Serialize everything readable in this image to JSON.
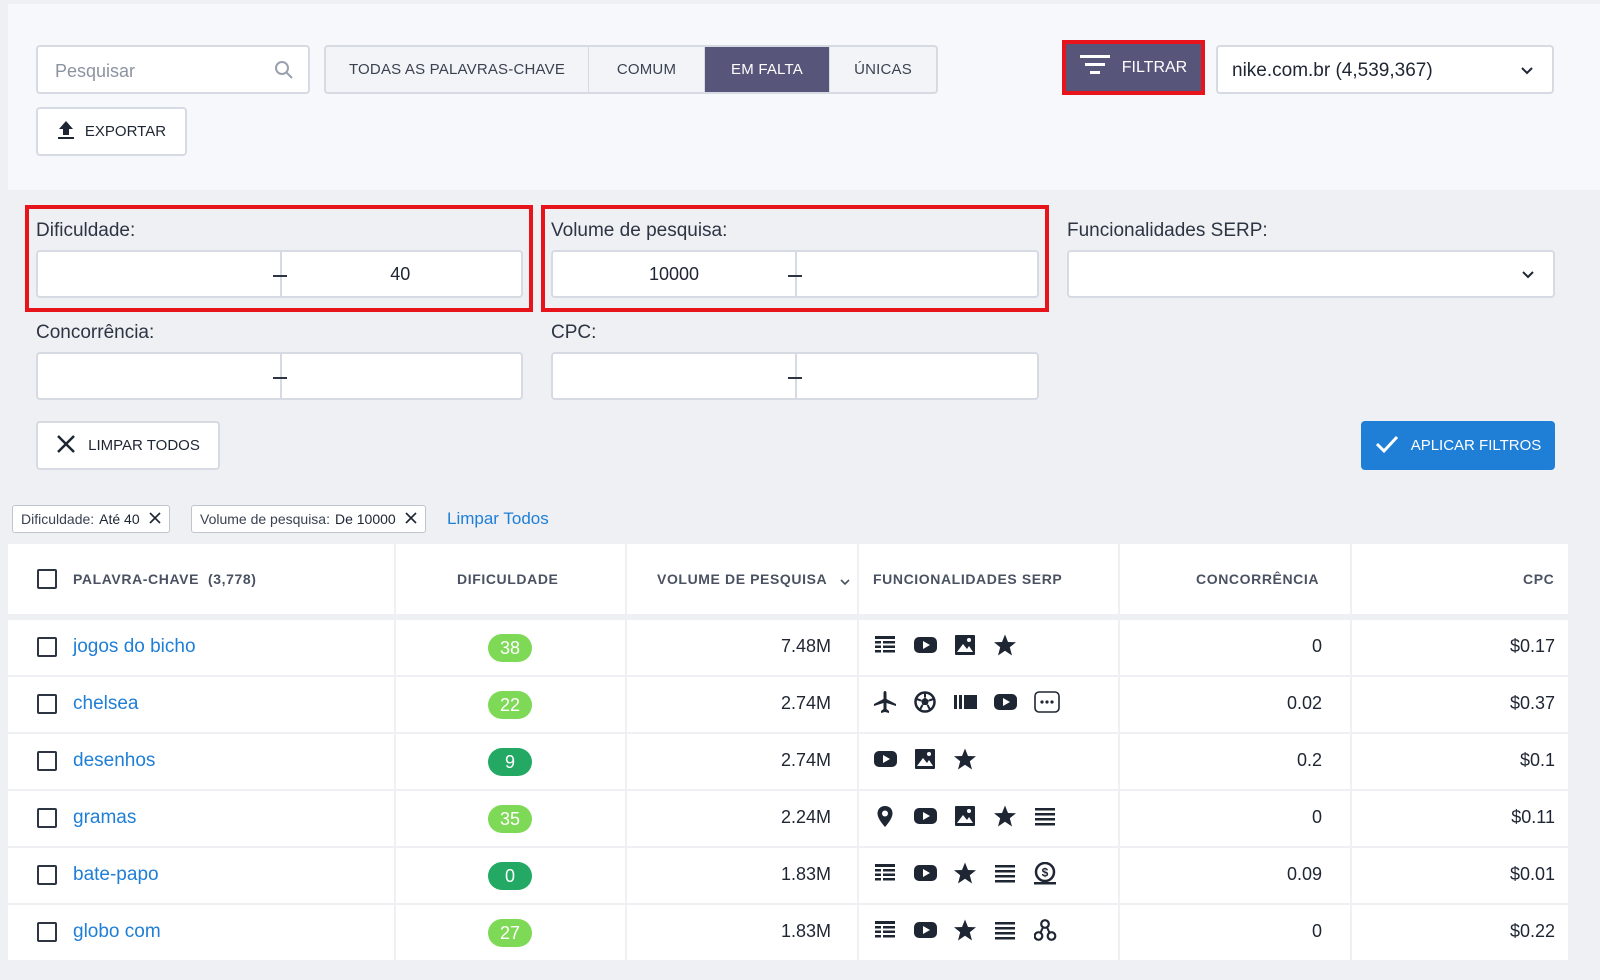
{
  "search": {
    "placeholder": "Pesquisar"
  },
  "tabs": [
    {
      "label": "TODAS AS PALAVRAS-CHAVE"
    },
    {
      "label": "COMUM"
    },
    {
      "label": "EM FALTA"
    },
    {
      "label": "ÚNICAS"
    }
  ],
  "toolbar": {
    "filter_label": "FILTRAR",
    "domain_label": "nike.com.br (4,539,367)",
    "export_label": "EXPORTAR"
  },
  "filters": {
    "difficulty": {
      "label": "Dificuldade:",
      "from": "",
      "to": "40"
    },
    "volume": {
      "label": "Volume de pesquisa:",
      "from": "10000",
      "to": ""
    },
    "serp": {
      "label": "Funcionalidades SERP:",
      "value": ""
    },
    "competition": {
      "label": "Concorrência:",
      "from": "",
      "to": ""
    },
    "cpc": {
      "label": "CPC:",
      "from": "",
      "to": ""
    },
    "clear_all_label": "LIMPAR TODOS",
    "apply_label": "APLICAR FILTROS"
  },
  "active_filters": {
    "chips": [
      {
        "name": "Dificuldade:",
        "value": "Até 40"
      },
      {
        "name": "Volume de pesquisa:",
        "value": "De 10000"
      }
    ],
    "clear_link": "Limpar Todos"
  },
  "table": {
    "headers": {
      "keyword": "PALAVRA-CHAVE",
      "keyword_count": "(3,778)",
      "difficulty": "DIFICULDADE",
      "volume": "VOLUME DE PESQUISA",
      "serp": "FUNCIONALIDADES SERP",
      "competition": "CONCORRÊNCIA",
      "cpc": "CPC"
    },
    "rows": [
      {
        "keyword": "jogos do bicho",
        "difficulty": "38",
        "difficulty_color": "#7ed957",
        "volume": "7.48M",
        "serp": [
          "table-icon",
          "video-icon",
          "image-icon",
          "star-icon"
        ],
        "competition": "0",
        "cpc": "$0.17"
      },
      {
        "keyword": "chelsea",
        "difficulty": "22",
        "difficulty_color": "#7ed957",
        "volume": "2.74M",
        "serp": [
          "flight-icon",
          "soccer-icon",
          "carousel-icon",
          "video-icon",
          "more-icon"
        ],
        "competition": "0.02",
        "cpc": "$0.37"
      },
      {
        "keyword": "desenhos",
        "difficulty": "9",
        "difficulty_color": "#23a963",
        "volume": "2.74M",
        "serp": [
          "video-icon",
          "image-icon",
          "star-icon"
        ],
        "competition": "0.2",
        "cpc": "$0.1"
      },
      {
        "keyword": "gramas",
        "difficulty": "35",
        "difficulty_color": "#7ed957",
        "volume": "2.24M",
        "serp": [
          "map-pin-icon",
          "video-icon",
          "image-icon",
          "star-icon",
          "list-icon"
        ],
        "competition": "0",
        "cpc": "$0.11"
      },
      {
        "keyword": "bate-papo",
        "difficulty": "0",
        "difficulty_color": "#23a963",
        "volume": "1.83M",
        "serp": [
          "table-icon",
          "video-icon",
          "star-icon",
          "list-icon",
          "ad-icon"
        ],
        "competition": "0.09",
        "cpc": "$0.01"
      },
      {
        "keyword": "globo com",
        "difficulty": "27",
        "difficulty_color": "#7ed957",
        "volume": "1.83M",
        "serp": [
          "table-icon",
          "video-icon",
          "star-icon",
          "list-icon",
          "network-icon"
        ],
        "competition": "0",
        "cpc": "$0.22"
      }
    ]
  }
}
